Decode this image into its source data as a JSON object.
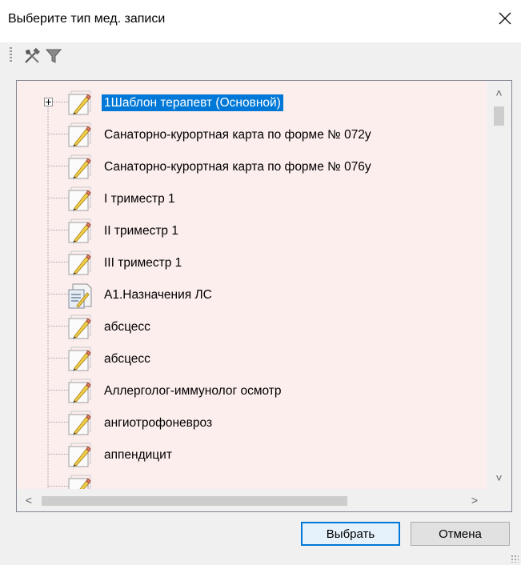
{
  "dialog": {
    "title": "Выберите тип мед. записи",
    "close_glyph": "✕"
  },
  "toolbar": {
    "items": [
      {
        "icon": "tools-icon"
      },
      {
        "icon": "filter-icon"
      }
    ]
  },
  "tree": {
    "items": [
      {
        "label": "1Шаблон терапевт (Основной)",
        "icon": "pencil-note-icon",
        "selected": true,
        "expandable": true
      },
      {
        "label": "Санаторно-курортная карта по форме № 072у",
        "icon": "pencil-note-icon"
      },
      {
        "label": "Санаторно-курортная карта по форме № 076у",
        "icon": "pencil-note-icon"
      },
      {
        "label": "I триместр 1",
        "icon": "pencil-note-icon"
      },
      {
        "label": "II триместр 1",
        "icon": "pencil-note-icon"
      },
      {
        "label": "III триместр 1",
        "icon": "pencil-note-icon"
      },
      {
        "label": "А1.Назначения ЛС",
        "icon": "document-pencil-icon"
      },
      {
        "label": "абсцесс",
        "icon": "pencil-note-icon"
      },
      {
        "label": "абсцесс",
        "icon": "pencil-note-icon"
      },
      {
        "label": "Аллерголог-иммунолог осмотр",
        "icon": "pencil-note-icon"
      },
      {
        "label": "ангиотрофоневроз",
        "icon": "pencil-note-icon"
      },
      {
        "label": "аппендицит",
        "icon": "pencil-note-icon"
      },
      {
        "label": "",
        "icon": "pencil-note-icon"
      }
    ],
    "tree_bg": "#fdeeee",
    "selection_color": "#0078d7"
  },
  "scrollbars": {
    "up": "˄",
    "down": "˅",
    "left": "<",
    "right": ">"
  },
  "buttons": {
    "ok": "Выбрать",
    "cancel": "Отмена"
  }
}
